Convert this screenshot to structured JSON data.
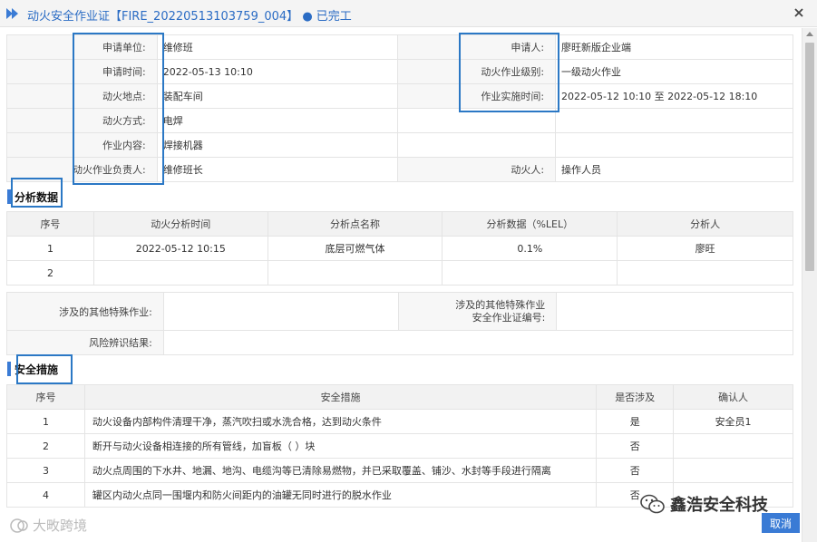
{
  "title": {
    "text": "动火安全作业证【FIRE_20220513103759_004】",
    "status": "● 已完工"
  },
  "info": {
    "apply_unit_label": "申请单位:",
    "apply_unit": "维修班",
    "applicant_label": "申请人:",
    "applicant": "廖旺新版企业端",
    "apply_time_label": "申请时间:",
    "apply_time": "2022-05-13 10:10",
    "fire_level_label": "动火作业级别:",
    "fire_level": "一级动火作业",
    "fire_place_label": "动火地点:",
    "fire_place": "装配车间",
    "impl_time_label": "作业实施时间:",
    "impl_time": "2022-05-12 10:10 至 2022-05-12 18:10",
    "fire_method_label": "动火方式:",
    "fire_method": "电焊",
    "work_content_label": "作业内容:",
    "work_content": "焊接机器",
    "leader_label": "动火作业负责人:",
    "leader": "维修班长",
    "fire_person_label": "动火人:",
    "fire_person": "操作人员"
  },
  "analysis": {
    "section_title": "分析数据",
    "headers": [
      "序号",
      "动火分析时间",
      "分析点名称",
      "分析数据（%LEL）",
      "分析人"
    ],
    "rows": [
      [
        "1",
        "2022-05-12 10:15",
        "底层可燃气体",
        "0.1%",
        "廖旺"
      ],
      [
        "2",
        "",
        "",
        "",
        ""
      ]
    ]
  },
  "other": {
    "special_work_label": "涉及的其他特殊作业:",
    "special_work": "",
    "cert_no_label_1": "涉及的其他特殊作业",
    "cert_no_label_2": "安全作业证编号:",
    "cert_no": "",
    "risk_label": "风险辨识结果:",
    "risk": ""
  },
  "measures": {
    "section_title": "安全措施",
    "headers": [
      "序号",
      "安全措施",
      "是否涉及",
      "确认人"
    ],
    "rows": [
      [
        "1",
        "动火设备内部构件清理干净，蒸汽吹扫或水洗合格，达到动火条件",
        "是",
        "安全员1"
      ],
      [
        "2",
        "断开与动火设备相连接的所有管线，加盲板（ ）块",
        "否",
        ""
      ],
      [
        "3",
        "动火点周围的下水井、地漏、地沟、电缆沟等已清除易燃物，并已采取覆盖、铺沙、水封等手段进行隔离",
        "否",
        ""
      ],
      [
        "4",
        "罐区内动火点同一围堰内和防火间距内的油罐无同时进行的脱水作业",
        "否",
        ""
      ]
    ]
  },
  "watermark_left": "大畋跨境",
  "watermark_right": "鑫浩安全科技",
  "cancel_label": "取消",
  "colors": {
    "accent": "#3a7bd5",
    "highlight": "#2b78c5"
  }
}
